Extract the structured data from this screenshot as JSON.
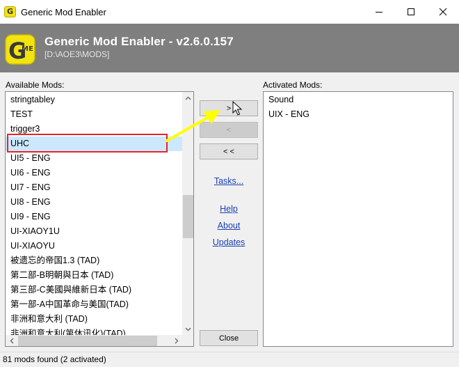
{
  "window": {
    "title": "Generic Mod Enabler",
    "app_icon_letter": "G"
  },
  "header": {
    "title": "Generic Mod Enabler - v2.6.0.157",
    "path": "[D:\\AOE3\\MODS]",
    "logo": {
      "letter": "G",
      "superscript": "ME",
      "color": "#f3e311"
    }
  },
  "available": {
    "label": "Available Mods:",
    "items": [
      "stringtabley",
      "TEST",
      "trigger3",
      "UHC",
      "UI5 - ENG",
      "UI6 - ENG",
      "UI7 - ENG",
      "UI8 - ENG",
      "UI9 - ENG",
      "UI-XIAOY1U",
      "UI-XIAOYU",
      "被遗忘的帝国1.3 (TAD)",
      "第二部-B明朝與日本 (TAD)",
      "第三部-C美國與維新日本 (TAD)",
      "第一部-A中国革命与美国(TAD)",
      "非洲和意大利 (TAD)",
      "非洲和意大利(第休讯化)(TAD)"
    ],
    "selected_index": 3
  },
  "activated": {
    "label": "Activated Mods:",
    "items": [
      "Sound",
      "UIX - ENG"
    ]
  },
  "buttons": {
    "add": ">",
    "remove": "<",
    "remove_all": "< <",
    "close": "Close"
  },
  "links": {
    "tasks": "Tasks...",
    "help": "Help",
    "about": "About",
    "updates": "Updates"
  },
  "status": {
    "text": "81 mods found (2 activated)"
  },
  "colors": {
    "header_bg": "#7f7f7f",
    "selection": "#cce8ff",
    "highlight_box": "#e2252a",
    "annotation_arrow": "#ffff00"
  }
}
